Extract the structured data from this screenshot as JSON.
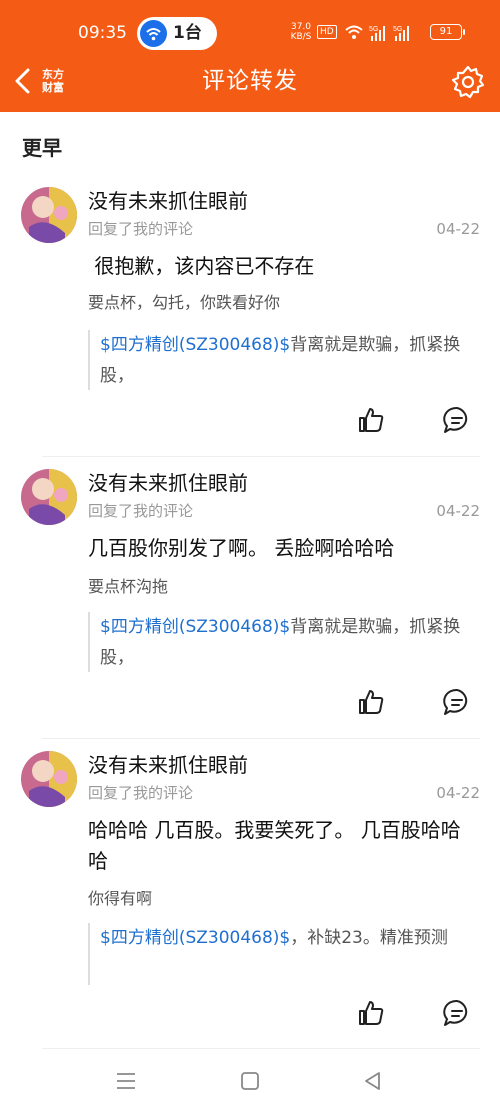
{
  "status_bar": {
    "time": "09:35",
    "pill_text": "1台",
    "net_speed": "37.0\nKB/S",
    "hd": "HD",
    "battery": "91"
  },
  "header": {
    "logo_text": "东方\n财富",
    "title": "评论转发",
    "back_icon": "chevron-left-icon",
    "settings_icon": "gear-icon"
  },
  "section": {
    "title": "更早"
  },
  "items": [
    {
      "username": "没有未来抓住眼前",
      "action": "回复了我的评论",
      "date": "04-22",
      "content": " 很抱歉，该内容已不存在",
      "my_comment": "要点杯，勾托，你跌看好你",
      "quote_stock": "$四方精创(SZ300468)$",
      "quote_text": "背离就是欺骗，抓紧换股，"
    },
    {
      "username": "没有未来抓住眼前",
      "action": "回复了我的评论",
      "date": "04-22",
      "content": "几百股你别发了啊。 丢脸啊哈哈哈",
      "my_comment": "要点杯沟拖",
      "quote_stock": "$四方精创(SZ300468)$",
      "quote_text": "背离就是欺骗，抓紧换股，"
    },
    {
      "username": "没有未来抓住眼前",
      "action": "回复了我的评论",
      "date": "04-22",
      "content": "哈哈哈 几百股。我要笑死了。 几百股哈哈哈",
      "my_comment": "你得有啊",
      "quote_stock": "$四方精创(SZ300468)$",
      "quote_text": "，补缺23。精准预测"
    }
  ],
  "icons": {
    "like": "thumbs-up-icon",
    "reply": "comment-icon"
  },
  "colors": {
    "brand": "#f45b14",
    "link": "#1f6fd0"
  }
}
